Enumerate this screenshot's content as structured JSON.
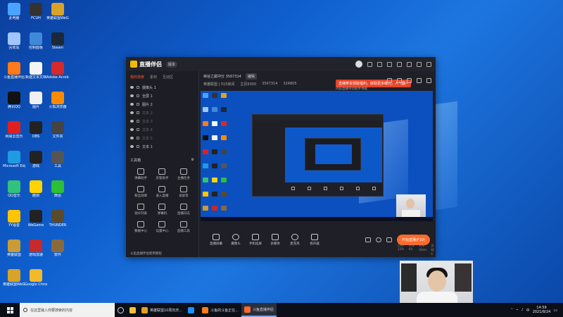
{
  "desktop_icons": [
    {
      "label": "此电脑",
      "color": "#4aa3ff"
    },
    {
      "label": "FCUH",
      "color": "#333"
    },
    {
      "label": "英雄联盟WeGame",
      "color": "#d8a326"
    },
    {
      "label": "回收站",
      "color": "#9fc6ff"
    },
    {
      "label": "控制面板",
      "color": "#3f89d9"
    },
    {
      "label": "Steam",
      "color": "#1b2838"
    },
    {
      "label": "斗鱼直播伴侣",
      "color": "#ff7a1a"
    },
    {
      "label": "新建文本文档",
      "color": "#f4f4f4"
    },
    {
      "label": "Adobe Acrobat",
      "color": "#d42a2a"
    },
    {
      "label": "腾讯QQ",
      "color": "#111"
    },
    {
      "label": "图片",
      "color": "#f0f0f0"
    },
    {
      "label": "火狐浏览器",
      "color": "#ff8a00"
    },
    {
      "label": "网易云音乐",
      "color": "#e02020"
    },
    {
      "label": "OBS",
      "color": "#222"
    },
    {
      "label": "文件夹",
      "color": "#444"
    },
    {
      "label": "Microsoft Edge",
      "color": "#1f9be0"
    },
    {
      "label": "游戏",
      "color": "#222"
    },
    {
      "label": "工具",
      "color": "#555"
    },
    {
      "label": "QQ音乐",
      "color": "#31c27c"
    },
    {
      "label": "酷狗",
      "color": "#ffd400"
    },
    {
      "label": "微信",
      "color": "#2bc036"
    },
    {
      "label": "YY语音",
      "color": "#ffc400"
    },
    {
      "label": "WeGame",
      "color": "#222"
    },
    {
      "label": "THUNDER",
      "color": "#5a4a2a"
    },
    {
      "label": "英雄联盟",
      "color": "#c99b36"
    },
    {
      "label": "游戏加速",
      "color": "#c62a2a"
    },
    {
      "label": "软件",
      "color": "#8a6a3a"
    },
    {
      "label": "英雄联盟WeGame",
      "color": "#d8a326"
    },
    {
      "label": "Google Chrome",
      "color": "#f2b92a"
    }
  ],
  "app": {
    "logo": "直播伴侣",
    "version": "版本",
    "tabs": [
      "我的场景",
      "素材",
      "互动区"
    ],
    "scenes": [
      {
        "name": "摄像头 1",
        "dim": false
      },
      {
        "name": "全屏 1",
        "dim": false
      },
      {
        "name": "图片 2",
        "dim": false
      },
      {
        "name": "文本 2",
        "dim": true
      },
      {
        "name": "文本 3",
        "dim": true
      },
      {
        "name": "文本 4",
        "dim": true
      },
      {
        "name": "文本 5",
        "dim": true
      },
      {
        "name": "文本 1",
        "dim": false
      }
    ],
    "tools_title": "工具箱",
    "tools": [
      "弹幕助手",
      "房管助手",
      "主播任务",
      "粉丝勋章",
      "录入直播",
      "录屏等",
      "观众列表",
      "弹幕机",
      "直播日志",
      "数据中心",
      "设置中心",
      "直播工具"
    ],
    "footer": "斗鱼直播伴侣使用教程",
    "room_title": "峡谷之巅冲分 3567314",
    "edit": "编辑",
    "promo": "直播带货领取福利，获取更多曝光，人气翻~",
    "sub_notice": "内容直播带货助手领取",
    "category": "英雄联盟 | 515房间",
    "followers": "主页5000",
    "room_id": "3567314",
    "hot": "324805",
    "bottom_buttons": [
      "直播屏幕",
      "摄像头",
      "手机投屏",
      "多媒体",
      "麦克风",
      "扬声器"
    ],
    "live_button": "开始直播(F10)",
    "stats": [
      "CPU: 33%",
      "FPS: 60",
      "码率: 0kb/s",
      "丢帧: 0"
    ]
  },
  "taskbar": {
    "search_placeholder": "在这里输入你要搜索的内容",
    "items": [
      {
        "label": "英雄联盟10周年庆...",
        "color": "#e0a020",
        "active": false
      },
      {
        "label": "",
        "color": "#1e90ff",
        "active": false
      },
      {
        "label": "斗鱼的斗鱼正在...",
        "color": "#ff7a1a",
        "active": false
      },
      {
        "label": "斗鱼直播伴侣",
        "color": "#ff6a2a",
        "active": true
      }
    ],
    "time": "14:59",
    "date": "2021/8/24"
  }
}
